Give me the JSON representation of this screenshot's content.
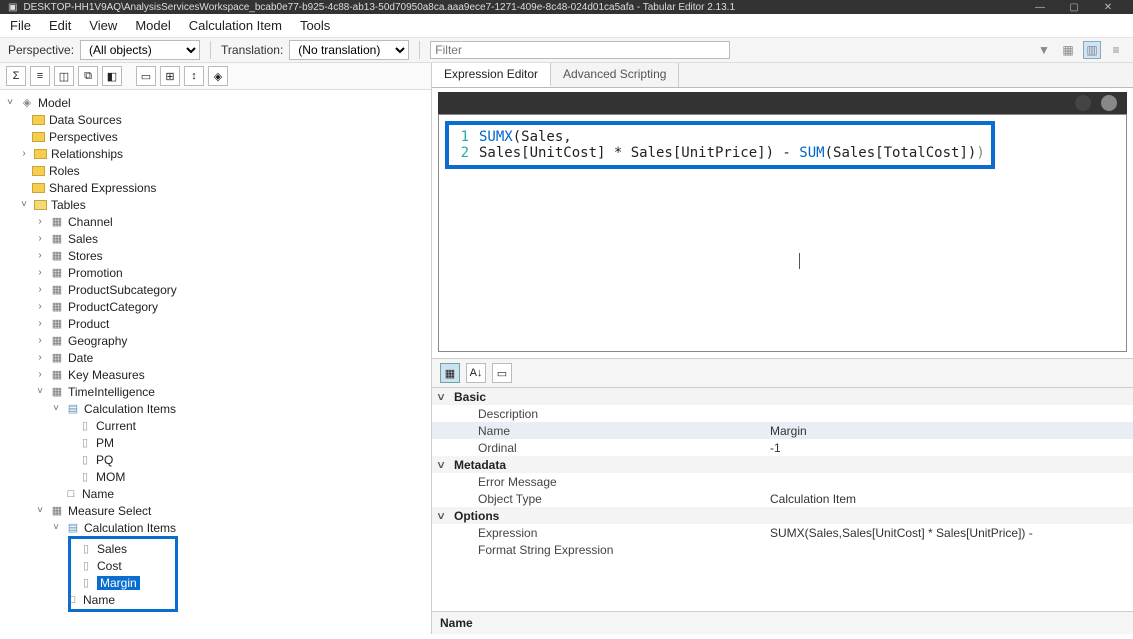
{
  "window": {
    "title": "DESKTOP-HH1V9AQ\\AnalysisServicesWorkspace_bcab0e77-b925-4c88-ab13-50d70950a8ca.aaa9ece7-1271-409e-8c48-024d01ca5afa - Tabular Editor 2.13.1"
  },
  "menu": [
    "File",
    "Edit",
    "View",
    "Model",
    "Calculation Item",
    "Tools"
  ],
  "subbar": {
    "perspective_label": "Perspective:",
    "perspective_value": "(All objects)",
    "translation_label": "Translation:",
    "translation_value": "(No translation)",
    "filter_placeholder": "Filter"
  },
  "left_tools": [
    "Σ",
    "≡",
    "◫",
    "⧉",
    "◧",
    "▭",
    "⊞",
    "↕",
    "◈"
  ],
  "tree": {
    "root": "Model",
    "folders": [
      "Data Sources",
      "Perspectives",
      "Relationships",
      "Roles",
      "Shared Expressions"
    ],
    "tables_label": "Tables",
    "tables": [
      "Channel",
      "Sales",
      "Stores",
      "Promotion",
      "ProductSubcategory",
      "ProductCategory",
      "Product",
      "Geography",
      "Date",
      "Key Measures"
    ],
    "timeintel": "TimeIntelligence",
    "calc_items_a": "Calculation Items",
    "ti_items": [
      "Current",
      "PM",
      "PQ",
      "MOM"
    ],
    "name": "Name",
    "measure_select": "Measure Select",
    "calc_items_b": "Calculation Items",
    "ms_items": [
      "Sales",
      "Cost",
      "Margin"
    ],
    "name_b": "Name"
  },
  "tabs": {
    "a": "Expression Editor",
    "b": "Advanced Scripting"
  },
  "code": {
    "l1_a": "SUMX",
    "l1_b": "(Sales,",
    "l2_a": "Sales[UnitCost] * Sales[UnitPrice]) - ",
    "l2_b": "SUM",
    "l2_c": "(Sales[TotalCost])",
    "l2_d": ")"
  },
  "prop_tools": [
    "▦",
    "A↓",
    "▭"
  ],
  "prop": {
    "groups": {
      "basic": "Basic",
      "metadata": "Metadata",
      "options": "Options"
    },
    "rows": {
      "description": "Description",
      "name": "Name",
      "name_val": "Margin",
      "ordinal": "Ordinal",
      "ordinal_val": "-1",
      "errmsg": "Error Message",
      "objtype": "Object Type",
      "objtype_val": "Calculation Item",
      "expression": "Expression",
      "expression_val": "SUMX(Sales,Sales[UnitCost] * Sales[UnitPrice]) -",
      "fse": "Format String Expression"
    }
  },
  "desc": {
    "title": "Name"
  }
}
